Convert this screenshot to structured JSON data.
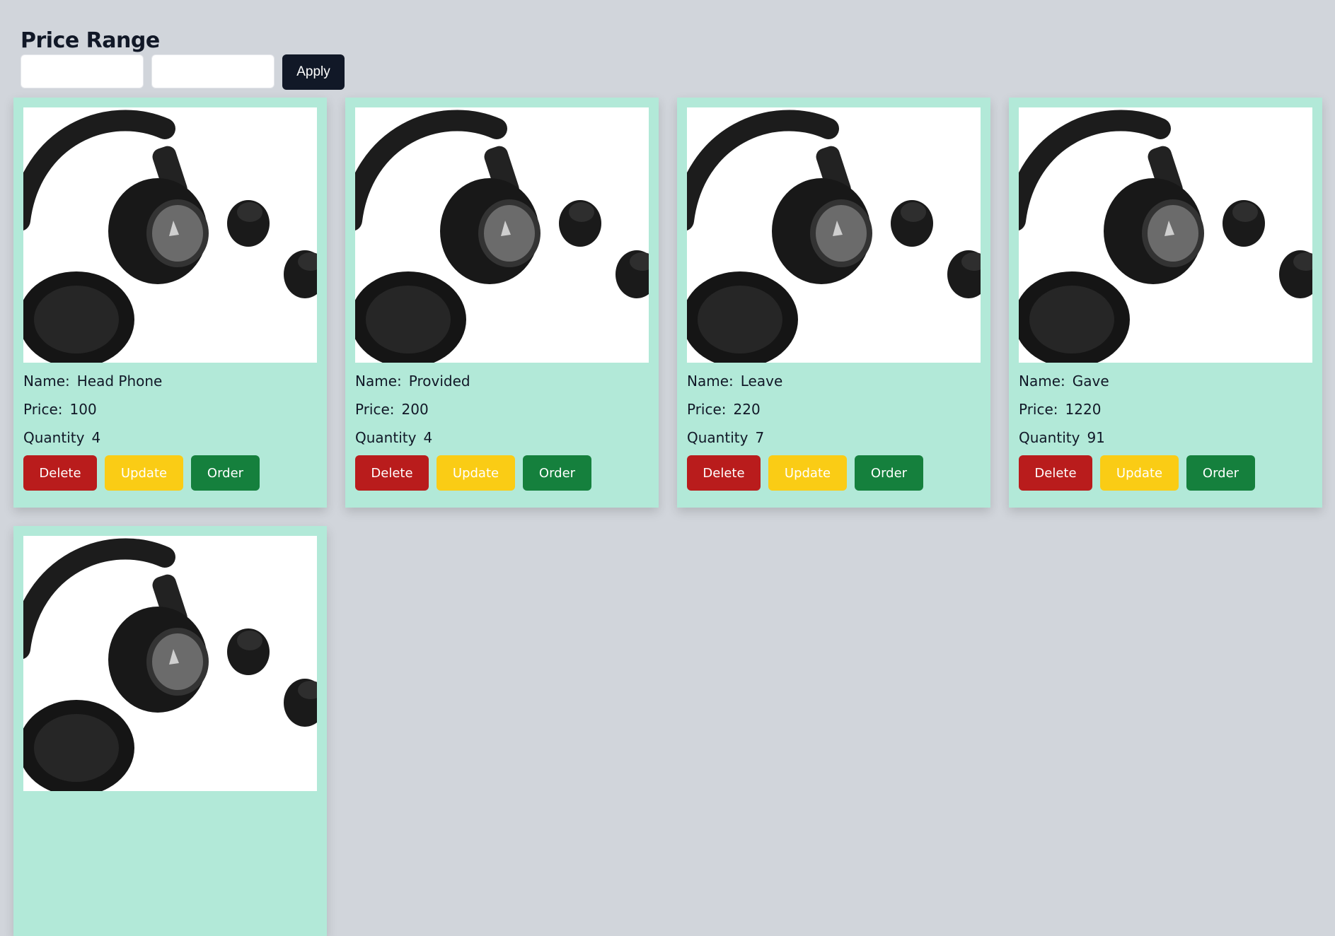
{
  "filter": {
    "title": "Price Range",
    "min_value": "",
    "max_value": "",
    "apply_label": "Apply"
  },
  "labels": {
    "name": "Name:",
    "price": "Price:",
    "quantity": "Quantity"
  },
  "buttons": {
    "delete": "Delete",
    "update": "Update",
    "order": "Order"
  },
  "products": [
    {
      "name": "Head Phone",
      "price": "100",
      "quantity": "4",
      "image": "headphones-earbuds-image"
    },
    {
      "name": "Provided",
      "price": "200",
      "quantity": "4",
      "image": "headphones-earbuds-image"
    },
    {
      "name": "Leave",
      "price": "220",
      "quantity": "7",
      "image": "headphones-earbuds-image"
    },
    {
      "name": "Gave",
      "price": "1220",
      "quantity": "91",
      "image": "headphones-earbuds-image"
    },
    {
      "name": "",
      "price": "",
      "quantity": "",
      "image": "headphones-earbuds-image"
    }
  ],
  "colors": {
    "page_bg": "#d1d5db",
    "card_bg": "#b2e9d8",
    "apply": "#111827",
    "delete": "#b91c1c",
    "update": "#facc15",
    "order": "#15803d"
  }
}
